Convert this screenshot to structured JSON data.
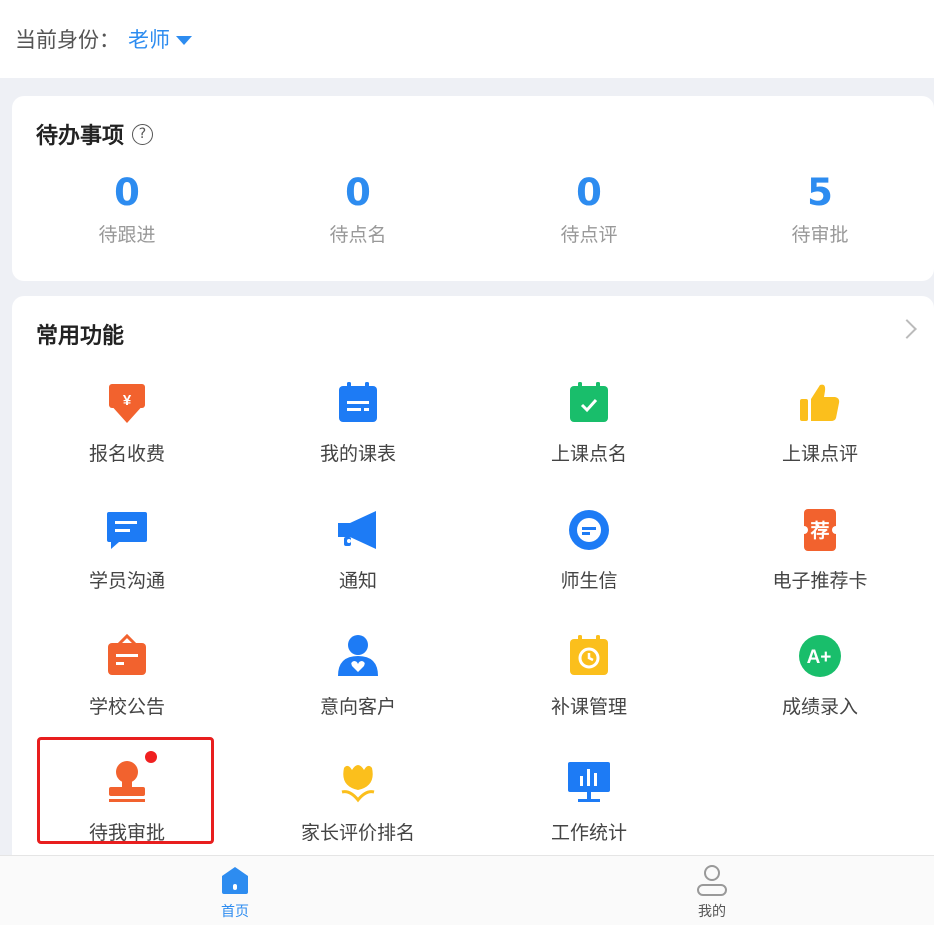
{
  "header": {
    "identity_label": "当前身份：",
    "identity_value": "老师"
  },
  "todo": {
    "title": "待办事项",
    "help_icon": "?",
    "stats": [
      {
        "value": "0",
        "label": "待跟进"
      },
      {
        "value": "0",
        "label": "待点名"
      },
      {
        "value": "0",
        "label": "待点评"
      },
      {
        "value": "5",
        "label": "待审批"
      }
    ]
  },
  "functions": {
    "title": "常用功能",
    "items": [
      {
        "label": "报名收费",
        "icon": "payment-icon"
      },
      {
        "label": "我的课表",
        "icon": "schedule-icon"
      },
      {
        "label": "上课点名",
        "icon": "attendance-icon"
      },
      {
        "label": "上课点评",
        "icon": "thumbs-up-icon"
      },
      {
        "label": "学员沟通",
        "icon": "chat-icon"
      },
      {
        "label": "通知",
        "icon": "megaphone-icon"
      },
      {
        "label": "师生信",
        "icon": "message-icon"
      },
      {
        "label": "电子推荐卡",
        "icon": "recommend-card-icon",
        "glyph": "荐"
      },
      {
        "label": "学校公告",
        "icon": "announcement-icon"
      },
      {
        "label": "意向客户",
        "icon": "customer-icon"
      },
      {
        "label": "补课管理",
        "icon": "makeup-class-icon"
      },
      {
        "label": "成绩录入",
        "icon": "grade-icon",
        "glyph": "A+"
      },
      {
        "label": "待我审批",
        "icon": "stamp-icon"
      },
      {
        "label": "家长评价排名",
        "icon": "flower-icon"
      },
      {
        "label": "工作统计",
        "icon": "statistics-icon"
      }
    ]
  },
  "tabbar": {
    "tabs": [
      {
        "label": "首页",
        "active": true
      },
      {
        "label": "我的",
        "active": false
      }
    ]
  },
  "colors": {
    "accent": "#2d8cf0",
    "orange": "#f2622e",
    "green": "#19be6b",
    "yellow": "#fbbf1c",
    "highlight": "#e81e1e"
  }
}
